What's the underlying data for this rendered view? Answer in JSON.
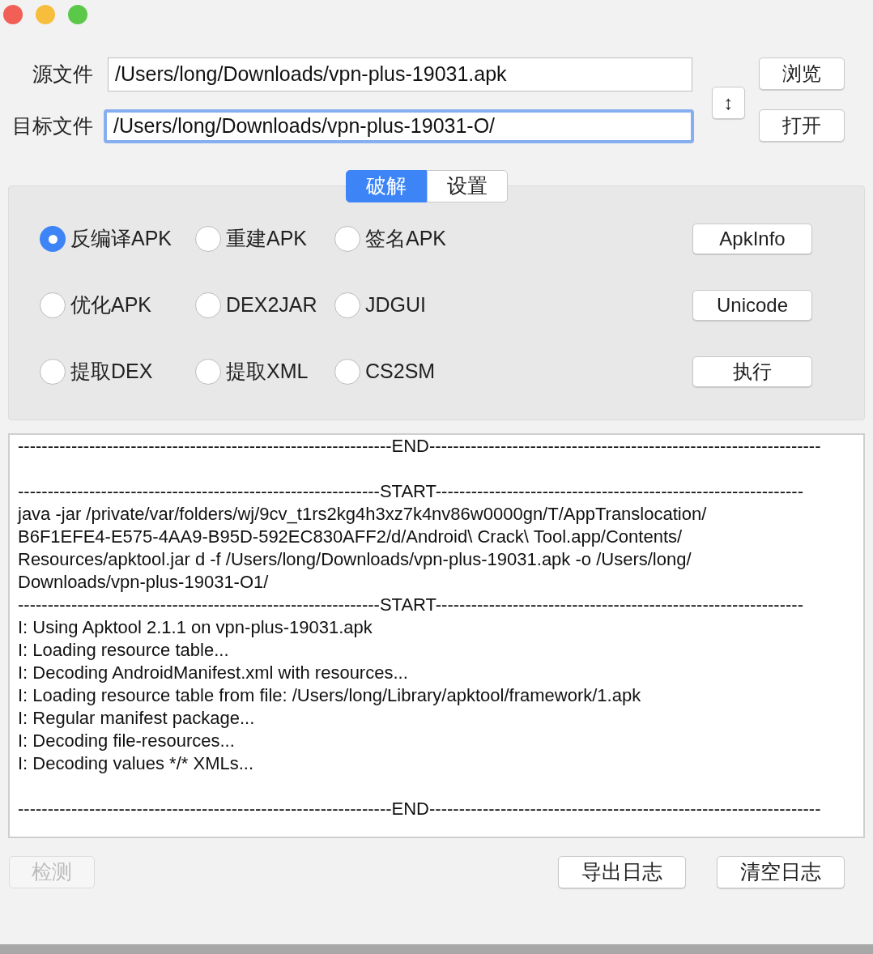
{
  "fields": [
    {
      "label": "源文件",
      "value": "/Users/long/Downloads/vpn-plus-19031.apk",
      "focused": false
    },
    {
      "label": "目标文件",
      "value": "/Users/long/Downloads/vpn-plus-19031-O/",
      "focused": true
    }
  ],
  "swap_button": "↕",
  "side_buttons": [
    "浏览",
    "打开"
  ],
  "tabs": [
    {
      "label": "破解",
      "selected": true
    },
    {
      "label": "设置",
      "selected": false
    }
  ],
  "options": [
    {
      "label": "反编译APK",
      "selected": true
    },
    {
      "label": "重建APK",
      "selected": false
    },
    {
      "label": "签名APK",
      "selected": false
    },
    {
      "label": "优化APK",
      "selected": false
    },
    {
      "label": "DEX2JAR",
      "selected": false
    },
    {
      "label": "JDGUI",
      "selected": false
    },
    {
      "label": "提取DEX",
      "selected": false
    },
    {
      "label": "提取XML",
      "selected": false
    },
    {
      "label": "CS2SM",
      "selected": false
    }
  ],
  "action_buttons": [
    "ApkInfo",
    "Unicode",
    "执行"
  ],
  "log": [
    {
      "kind": "text",
      "text": "---------------------------------------------------------------END------------------------------------------------------------------"
    },
    {
      "kind": "blank"
    },
    {
      "kind": "text",
      "text": "-------------------------------------------------------------START--------------------------------------------------------------"
    },
    {
      "kind": "text",
      "text": "java -jar /private/var/folders/wj/9cv_t1rs2kg4h3xz7k4nv86w0000gn/T/AppTranslocation/"
    },
    {
      "kind": "text",
      "text": "B6F1EFE4-E575-4AA9-B95D-592EC830AFF2/d/Android\\ Crack\\ Tool.app/Contents/"
    },
    {
      "kind": "text",
      "text": "Resources/apktool.jar d -f /Users/long/Downloads/vpn-plus-19031.apk -o /Users/long/"
    },
    {
      "kind": "text",
      "text": "Downloads/vpn-plus-19031-O1/"
    },
    {
      "kind": "text",
      "text": "-------------------------------------------------------------START--------------------------------------------------------------"
    },
    {
      "kind": "text",
      "text": "I: Using Apktool 2.1.1 on vpn-plus-19031.apk"
    },
    {
      "kind": "text",
      "text": "I: Loading resource table..."
    },
    {
      "kind": "text",
      "text": "I: Decoding AndroidManifest.xml with resources..."
    },
    {
      "kind": "text",
      "text": "I: Loading resource table from file: /Users/long/Library/apktool/framework/1.apk"
    },
    {
      "kind": "text",
      "text": "I: Regular manifest package..."
    },
    {
      "kind": "text",
      "text": "I: Decoding file-resources..."
    },
    {
      "kind": "text",
      "text": "I: Decoding values */* XMLs..."
    },
    {
      "kind": "blank"
    },
    {
      "kind": "text",
      "text": "---------------------------------------------------------------END------------------------------------------------------------------"
    }
  ],
  "bottom_buttons": [
    {
      "label": "检测",
      "disabled": true
    },
    {
      "label": "导出日志",
      "disabled": false
    },
    {
      "label": "清空日志",
      "disabled": false
    }
  ]
}
